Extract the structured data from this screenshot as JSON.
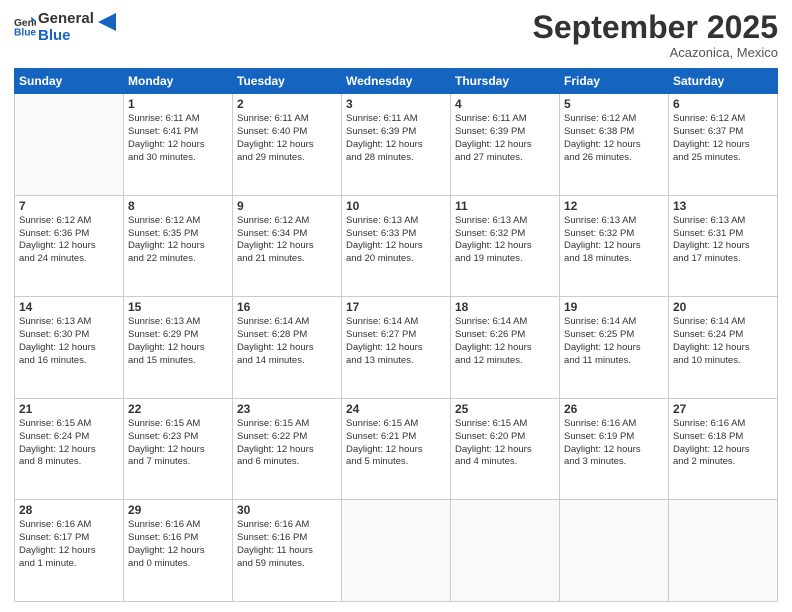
{
  "logo": {
    "line1": "General",
    "line2": "Blue"
  },
  "header": {
    "month": "September 2025",
    "location": "Acazonica, Mexico"
  },
  "weekdays": [
    "Sunday",
    "Monday",
    "Tuesday",
    "Wednesday",
    "Thursday",
    "Friday",
    "Saturday"
  ],
  "weeks": [
    [
      {
        "day": "",
        "info": ""
      },
      {
        "day": "1",
        "info": "Sunrise: 6:11 AM\nSunset: 6:41 PM\nDaylight: 12 hours\nand 30 minutes."
      },
      {
        "day": "2",
        "info": "Sunrise: 6:11 AM\nSunset: 6:40 PM\nDaylight: 12 hours\nand 29 minutes."
      },
      {
        "day": "3",
        "info": "Sunrise: 6:11 AM\nSunset: 6:39 PM\nDaylight: 12 hours\nand 28 minutes."
      },
      {
        "day": "4",
        "info": "Sunrise: 6:11 AM\nSunset: 6:39 PM\nDaylight: 12 hours\nand 27 minutes."
      },
      {
        "day": "5",
        "info": "Sunrise: 6:12 AM\nSunset: 6:38 PM\nDaylight: 12 hours\nand 26 minutes."
      },
      {
        "day": "6",
        "info": "Sunrise: 6:12 AM\nSunset: 6:37 PM\nDaylight: 12 hours\nand 25 minutes."
      }
    ],
    [
      {
        "day": "7",
        "info": "Sunrise: 6:12 AM\nSunset: 6:36 PM\nDaylight: 12 hours\nand 24 minutes."
      },
      {
        "day": "8",
        "info": "Sunrise: 6:12 AM\nSunset: 6:35 PM\nDaylight: 12 hours\nand 22 minutes."
      },
      {
        "day": "9",
        "info": "Sunrise: 6:12 AM\nSunset: 6:34 PM\nDaylight: 12 hours\nand 21 minutes."
      },
      {
        "day": "10",
        "info": "Sunrise: 6:13 AM\nSunset: 6:33 PM\nDaylight: 12 hours\nand 20 minutes."
      },
      {
        "day": "11",
        "info": "Sunrise: 6:13 AM\nSunset: 6:32 PM\nDaylight: 12 hours\nand 19 minutes."
      },
      {
        "day": "12",
        "info": "Sunrise: 6:13 AM\nSunset: 6:32 PM\nDaylight: 12 hours\nand 18 minutes."
      },
      {
        "day": "13",
        "info": "Sunrise: 6:13 AM\nSunset: 6:31 PM\nDaylight: 12 hours\nand 17 minutes."
      }
    ],
    [
      {
        "day": "14",
        "info": "Sunrise: 6:13 AM\nSunset: 6:30 PM\nDaylight: 12 hours\nand 16 minutes."
      },
      {
        "day": "15",
        "info": "Sunrise: 6:13 AM\nSunset: 6:29 PM\nDaylight: 12 hours\nand 15 minutes."
      },
      {
        "day": "16",
        "info": "Sunrise: 6:14 AM\nSunset: 6:28 PM\nDaylight: 12 hours\nand 14 minutes."
      },
      {
        "day": "17",
        "info": "Sunrise: 6:14 AM\nSunset: 6:27 PM\nDaylight: 12 hours\nand 13 minutes."
      },
      {
        "day": "18",
        "info": "Sunrise: 6:14 AM\nSunset: 6:26 PM\nDaylight: 12 hours\nand 12 minutes."
      },
      {
        "day": "19",
        "info": "Sunrise: 6:14 AM\nSunset: 6:25 PM\nDaylight: 12 hours\nand 11 minutes."
      },
      {
        "day": "20",
        "info": "Sunrise: 6:14 AM\nSunset: 6:24 PM\nDaylight: 12 hours\nand 10 minutes."
      }
    ],
    [
      {
        "day": "21",
        "info": "Sunrise: 6:15 AM\nSunset: 6:24 PM\nDaylight: 12 hours\nand 8 minutes."
      },
      {
        "day": "22",
        "info": "Sunrise: 6:15 AM\nSunset: 6:23 PM\nDaylight: 12 hours\nand 7 minutes."
      },
      {
        "day": "23",
        "info": "Sunrise: 6:15 AM\nSunset: 6:22 PM\nDaylight: 12 hours\nand 6 minutes."
      },
      {
        "day": "24",
        "info": "Sunrise: 6:15 AM\nSunset: 6:21 PM\nDaylight: 12 hours\nand 5 minutes."
      },
      {
        "day": "25",
        "info": "Sunrise: 6:15 AM\nSunset: 6:20 PM\nDaylight: 12 hours\nand 4 minutes."
      },
      {
        "day": "26",
        "info": "Sunrise: 6:16 AM\nSunset: 6:19 PM\nDaylight: 12 hours\nand 3 minutes."
      },
      {
        "day": "27",
        "info": "Sunrise: 6:16 AM\nSunset: 6:18 PM\nDaylight: 12 hours\nand 2 minutes."
      }
    ],
    [
      {
        "day": "28",
        "info": "Sunrise: 6:16 AM\nSunset: 6:17 PM\nDaylight: 12 hours\nand 1 minute."
      },
      {
        "day": "29",
        "info": "Sunrise: 6:16 AM\nSunset: 6:16 PM\nDaylight: 12 hours\nand 0 minutes."
      },
      {
        "day": "30",
        "info": "Sunrise: 6:16 AM\nSunset: 6:16 PM\nDaylight: 11 hours\nand 59 minutes."
      },
      {
        "day": "",
        "info": ""
      },
      {
        "day": "",
        "info": ""
      },
      {
        "day": "",
        "info": ""
      },
      {
        "day": "",
        "info": ""
      }
    ]
  ]
}
